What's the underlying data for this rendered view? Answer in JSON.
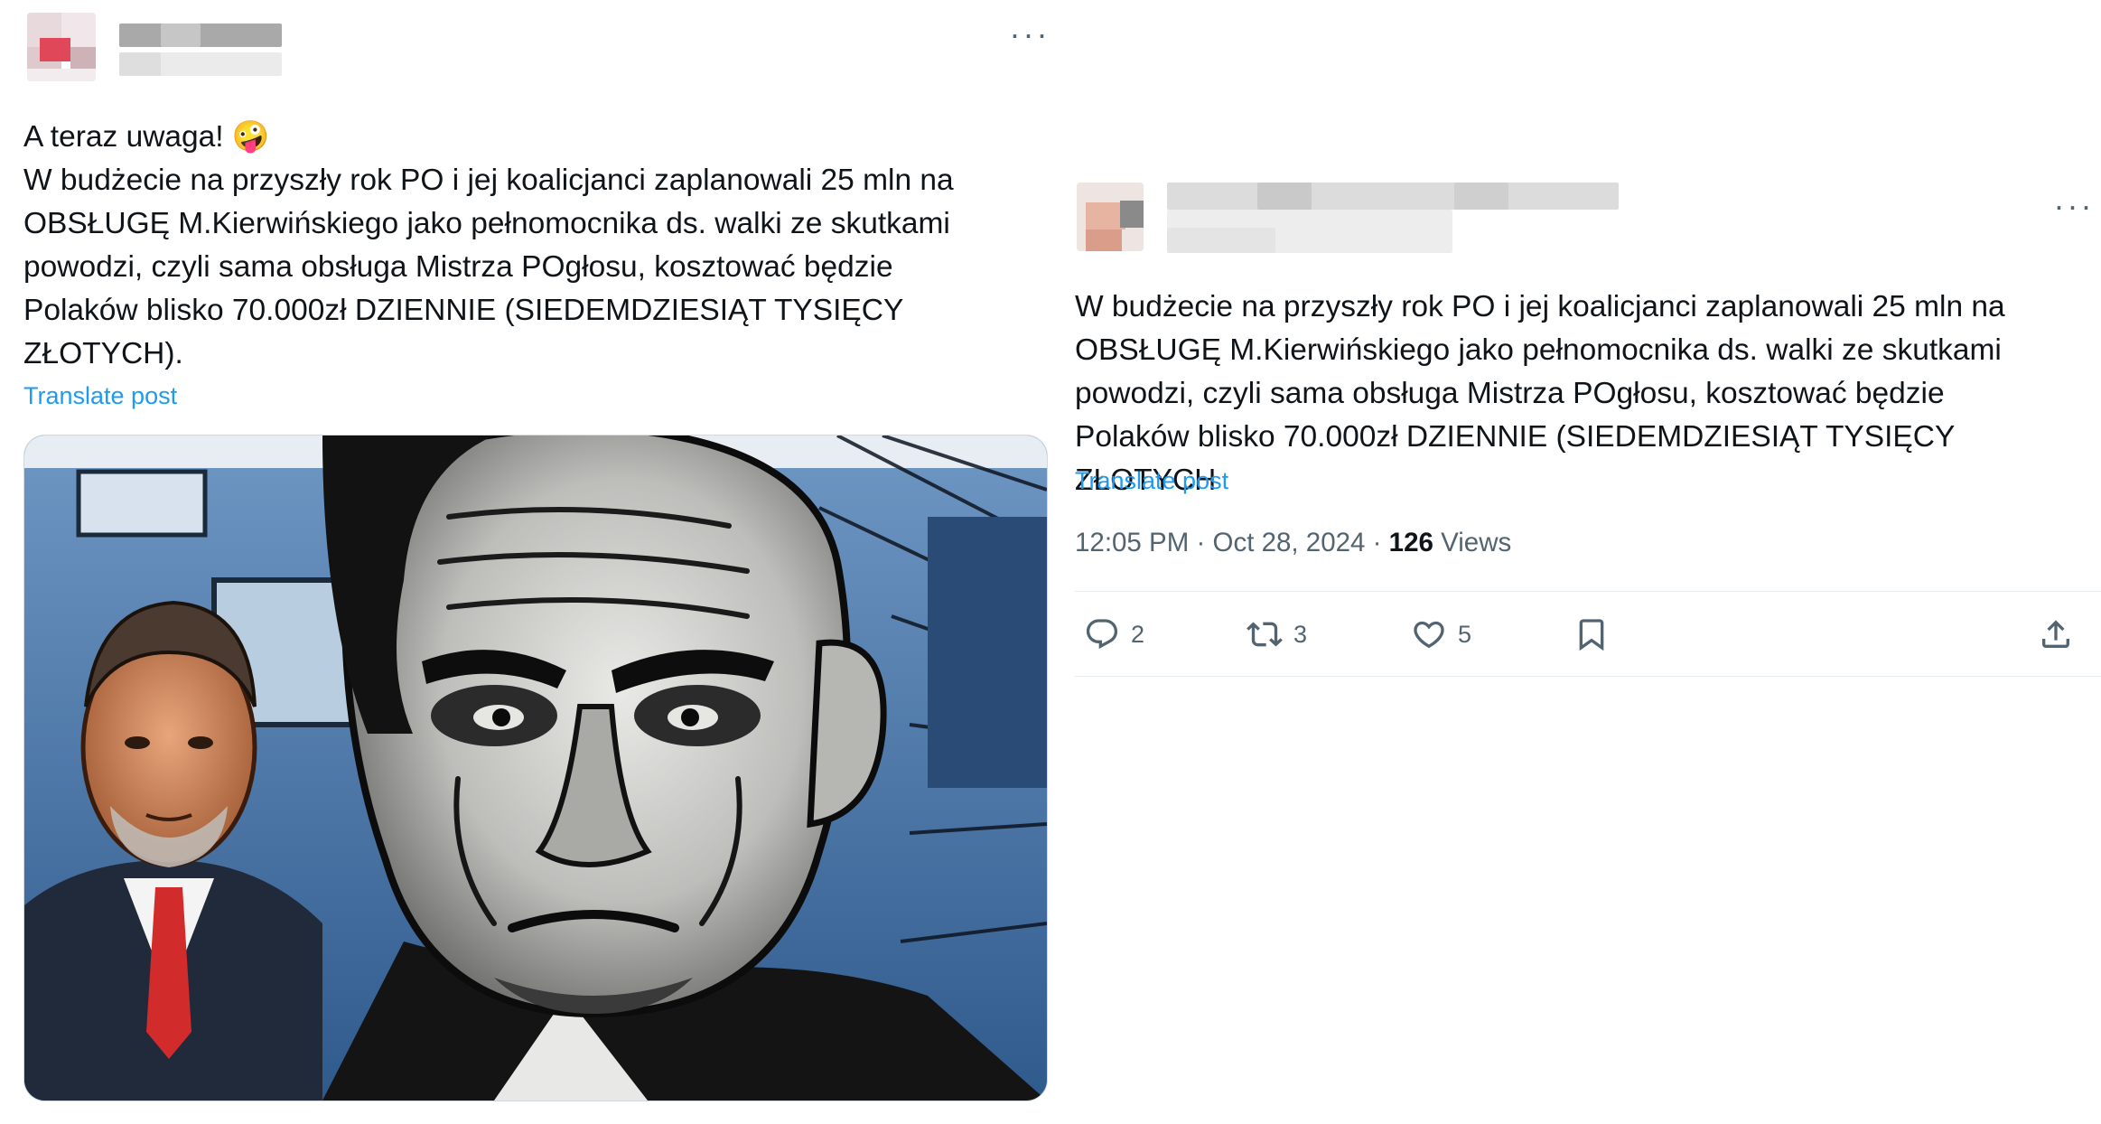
{
  "left_post": {
    "more_label": "···",
    "text_line1": "A teraz uwaga! ",
    "emoji": "🤪",
    "text_body": "W budżecie na przyszły rok PO i jej koalicjanci zaplanowali 25 mln na\nOBSŁUGĘ M.Kierwińskiego jako pełnomocnika ds. walki ze skutkami\npowodzi, czyli sama obsługa Mistrza POgłosu, kosztować będzie\nPolaków blisko 70.000zł DZIENNIE (SIEDEMDZIESIĄT TYSIĘCY\nZŁOTYCH).",
    "translate_label": "Translate post"
  },
  "right_post": {
    "more_label": "···",
    "text_body": "W budżecie na przyszły rok PO i jej koalicjanci zaplanowali 25 mln na\nOBSŁUGĘ M.Kierwińskiego jako pełnomocnika ds. walki ze skutkami\npowodzi, czyli sama obsługa Mistrza POgłosu, kosztować będzie\nPolaków blisko 70.000zł DZIENNIE (SIEDEMDZIESIĄT TYSIĘCY ZŁOTYCH",
    "translate_label": "Translate post",
    "time": "12:05 PM",
    "date": "Oct 28, 2024",
    "views_count": "126",
    "views_label": "Views",
    "actions": {
      "replies": "2",
      "reposts": "3",
      "likes": "5"
    }
  },
  "colors": {
    "link_blue": "#1d9bf0",
    "text_primary": "#0f1419",
    "text_secondary": "#536471",
    "divider": "#e6ecf0"
  }
}
